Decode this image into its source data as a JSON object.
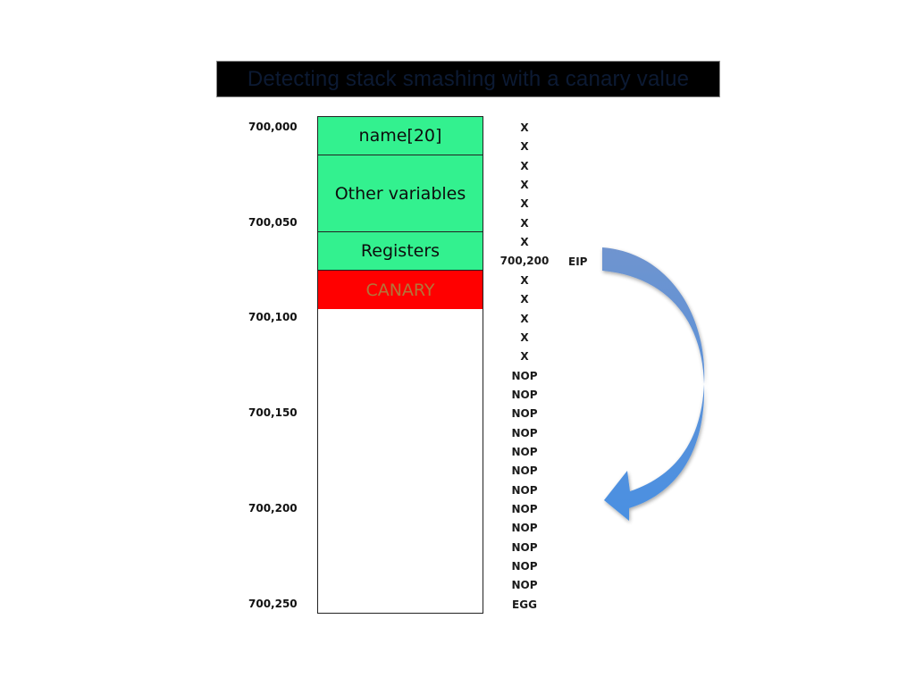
{
  "title": "Detecting stack smashing with a canary value",
  "address_labels": [
    "700,000",
    "700,050",
    "700,100",
    "700,150",
    "700,200",
    "700,250"
  ],
  "stack_blocks": [
    {
      "label": "name[20]",
      "color": "#33f18f"
    },
    {
      "label": "Other variables",
      "color": "#33f18f"
    },
    {
      "label": "Registers",
      "color": "#33f18f"
    },
    {
      "label": "CANARY",
      "color": "#ff0000",
      "text_color": "#b3753a"
    }
  ],
  "payload_column": [
    "X",
    "X",
    "X",
    "X",
    "X",
    "X",
    "X",
    "700,200",
    "X",
    "X",
    "X",
    "X",
    "X",
    "NOP",
    "NOP",
    "NOP",
    "NOP",
    "NOP",
    "NOP",
    "NOP",
    "NOP",
    "NOP",
    "NOP",
    "NOP",
    "NOP",
    "EGG"
  ],
  "eip_label": "EIP",
  "arrow_color": "#5b9bd5"
}
